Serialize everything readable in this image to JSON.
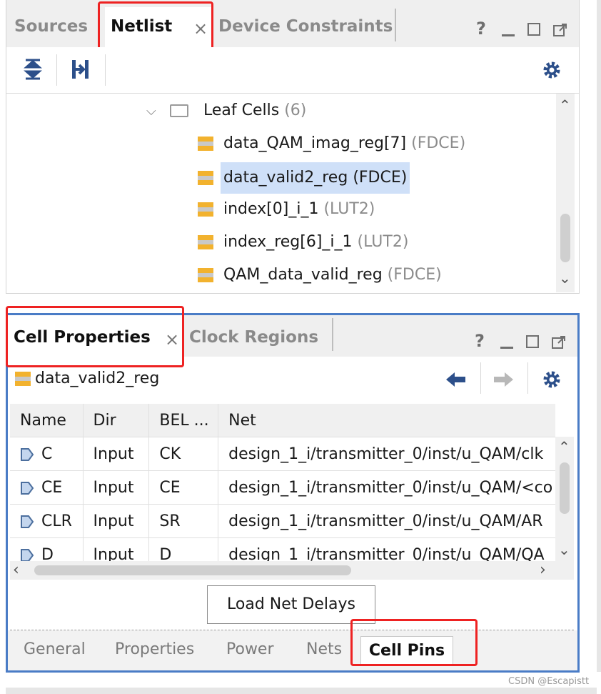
{
  "netlist_panel": {
    "tabs": [
      {
        "label": "Sources",
        "active": false
      },
      {
        "label": "Netlist",
        "active": true
      },
      {
        "label": "Device Constraints",
        "active": false
      }
    ],
    "window_buttons": [
      "?",
      "_",
      "□",
      "⤢"
    ],
    "tree": {
      "group": {
        "label": "Leaf Cells",
        "count": "(6)"
      },
      "items": [
        {
          "name": "data_QAM_imag_reg[7]",
          "type": "(FDCE)",
          "selected": false
        },
        {
          "name": "data_valid2_reg",
          "type": "(FDCE)",
          "selected": true
        },
        {
          "name": "index[0]_i_1",
          "type": "(LUT2)",
          "selected": false
        },
        {
          "name": "index_reg[6]_i_1",
          "type": "(LUT2)",
          "selected": false
        },
        {
          "name": "QAM_data_valid_reg",
          "type": "(FDCE)",
          "selected": false
        }
      ]
    }
  },
  "properties_panel": {
    "tabs": [
      {
        "label": "Cell Properties",
        "active": true
      },
      {
        "label": "Clock Regions",
        "active": false
      }
    ],
    "cell_name": "data_valid2_reg",
    "table": {
      "columns": [
        "Name",
        "Dir",
        "BEL ...",
        "Net"
      ],
      "rows": [
        {
          "name": "C",
          "dir": "Input",
          "bel": "CK",
          "net": "design_1_i/transmitter_0/inst/u_QAM/clk"
        },
        {
          "name": "CE",
          "dir": "Input",
          "bel": "CE",
          "net": "design_1_i/transmitter_0/inst/u_QAM/<co"
        },
        {
          "name": "CLR",
          "dir": "Input",
          "bel": "SR",
          "net": "design_1_i/transmitter_0/inst/u_QAM/AR"
        },
        {
          "name": "D",
          "dir": "Input",
          "bel": "D",
          "net": "design_1_i/transmitter_0/inst/u_QAM/QA"
        }
      ]
    },
    "load_button": "Load Net Delays",
    "bottom_tabs": [
      {
        "label": "General",
        "active": false
      },
      {
        "label": "Properties",
        "active": false
      },
      {
        "label": "Power",
        "active": false
      },
      {
        "label": "Nets",
        "active": false
      },
      {
        "label": "Cell Pins",
        "active": true
      }
    ]
  },
  "watermark": "CSDN @Escapistt",
  "colors": {
    "accent_blue": "#4a7cc6",
    "highlight_red": "#ee2222",
    "selection": "#cfe0f8",
    "cell_orange": "#f2b22e",
    "icon_blue": "#2c4f8a"
  }
}
